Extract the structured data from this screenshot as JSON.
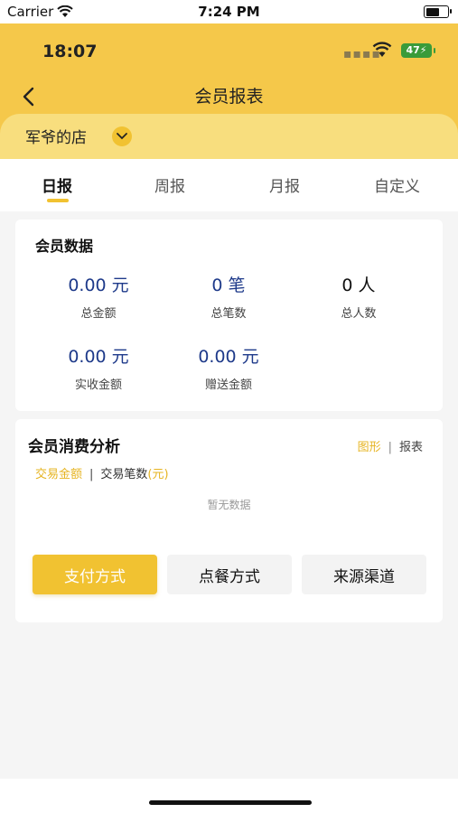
{
  "system_status": {
    "carrier": "Carrier",
    "time": "7:24 PM"
  },
  "inner_status": {
    "time": "18:07",
    "battery": "47"
  },
  "nav": {
    "title": "会员报表"
  },
  "store": {
    "name": "军爷的店"
  },
  "tabs": [
    {
      "label": "日报",
      "active": true
    },
    {
      "label": "周报",
      "active": false
    },
    {
      "label": "月报",
      "active": false
    },
    {
      "label": "自定义",
      "active": false
    }
  ],
  "member_data": {
    "title": "会员数据",
    "stats": [
      {
        "value": "0.00 元",
        "label": "总金额"
      },
      {
        "value": "0 笔",
        "label": "总笔数"
      },
      {
        "value": "0 人",
        "label": "总人数"
      },
      {
        "value": "0.00 元",
        "label": "实收金额"
      },
      {
        "value": "0.00 元",
        "label": "赠送金额"
      }
    ]
  },
  "consumption": {
    "title": "会员消费分析",
    "view_chart": "图形",
    "view_sep": "|",
    "view_table": "报表",
    "metric_amount": "交易金额",
    "metric_sep": "|",
    "metric_count": "交易笔数",
    "metric_unit": "(元)",
    "empty": "暂无数据",
    "buttons": [
      {
        "label": "支付方式",
        "active": true
      },
      {
        "label": "点餐方式",
        "active": false
      },
      {
        "label": "来源渠道",
        "active": false
      }
    ]
  },
  "colors": {
    "accent": "#f1c231",
    "header": "#f5c84a",
    "value_blue": "#1e3a8a"
  }
}
